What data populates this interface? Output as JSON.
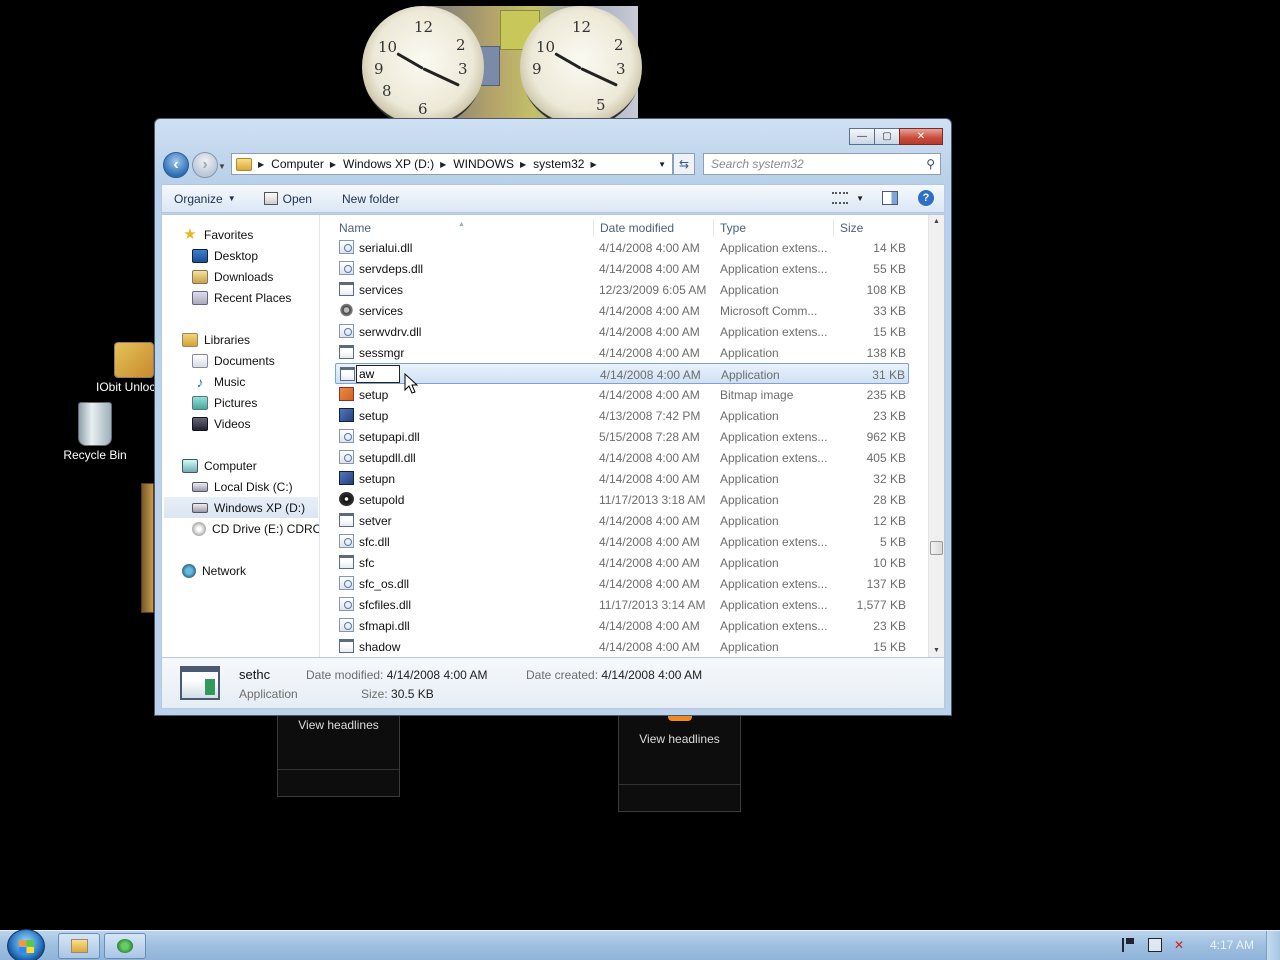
{
  "desktop": {
    "icons": [
      {
        "label": "IObit Unlocker"
      },
      {
        "label": "Recycle Bin"
      }
    ],
    "gadgets": {
      "headlines_left": "View headlines",
      "headlines_right": "View headlines"
    }
  },
  "window": {
    "caption_buttons": {
      "minimize": "—",
      "maximize": "▢",
      "close": "✕"
    },
    "address": {
      "crumbs": [
        "Computer",
        "Windows XP (D:)",
        "WINDOWS",
        "system32"
      ]
    },
    "search": {
      "placeholder": "Search system32"
    },
    "toolbar": {
      "organize": "Organize",
      "open": "Open",
      "new_folder": "New folder"
    },
    "nav_pane": {
      "favorites": "Favorites",
      "desktop": "Desktop",
      "downloads": "Downloads",
      "recent_places": "Recent Places",
      "libraries": "Libraries",
      "documents": "Documents",
      "music": "Music",
      "pictures": "Pictures",
      "videos": "Videos",
      "computer": "Computer",
      "local_disk": "Local Disk (C:)",
      "windows_xp": "Windows XP (D:)",
      "cd_drive": "CD Drive (E:) CDROM",
      "network": "Network"
    },
    "columns": {
      "name": "Name",
      "date": "Date modified",
      "type": "Type",
      "size": "Size"
    },
    "files": [
      {
        "name": "serialui.dll",
        "date": "4/14/2008 4:00 AM",
        "type": "Application extens...",
        "size": "14 KB",
        "icon": "dll"
      },
      {
        "name": "servdeps.dll",
        "date": "4/14/2008 4:00 AM",
        "type": "Application extens...",
        "size": "55 KB",
        "icon": "dll"
      },
      {
        "name": "services",
        "date": "12/23/2009 6:05 AM",
        "type": "Application",
        "size": "108 KB",
        "icon": "app"
      },
      {
        "name": "services",
        "date": "4/14/2008 4:00 AM",
        "type": "Microsoft Comm...",
        "size": "33 KB",
        "icon": "gear"
      },
      {
        "name": "serwvdrv.dll",
        "date": "4/14/2008 4:00 AM",
        "type": "Application extens...",
        "size": "15 KB",
        "icon": "dll"
      },
      {
        "name": "sessmgr",
        "date": "4/14/2008 4:00 AM",
        "type": "Application",
        "size": "138 KB",
        "icon": "app"
      },
      {
        "name": "aw",
        "date": "4/14/2008 4:00 AM",
        "type": "Application",
        "size": "31 KB",
        "icon": "app",
        "selected": true
      },
      {
        "name": "setup",
        "date": "4/14/2008 4:00 AM",
        "type": "Bitmap image",
        "size": "235 KB",
        "icon": "bmp"
      },
      {
        "name": "setup",
        "date": "4/13/2008 7:42 PM",
        "type": "Application",
        "size": "23 KB",
        "icon": "setup"
      },
      {
        "name": "setupapi.dll",
        "date": "5/15/2008 7:28 AM",
        "type": "Application extens...",
        "size": "962 KB",
        "icon": "dll"
      },
      {
        "name": "setupdll.dll",
        "date": "4/14/2008 4:00 AM",
        "type": "Application extens...",
        "size": "405 KB",
        "icon": "dll"
      },
      {
        "name": "setupn",
        "date": "4/14/2008 4:00 AM",
        "type": "Application",
        "size": "32 KB",
        "icon": "setup"
      },
      {
        "name": "setupold",
        "date": "11/17/2013 3:18 AM",
        "type": "Application",
        "size": "28 KB",
        "icon": "black"
      },
      {
        "name": "setver",
        "date": "4/14/2008 4:00 AM",
        "type": "Application",
        "size": "12 KB",
        "icon": "app"
      },
      {
        "name": "sfc.dll",
        "date": "4/14/2008 4:00 AM",
        "type": "Application extens...",
        "size": "5 KB",
        "icon": "dll"
      },
      {
        "name": "sfc",
        "date": "4/14/2008 4:00 AM",
        "type": "Application",
        "size": "10 KB",
        "icon": "app"
      },
      {
        "name": "sfc_os.dll",
        "date": "4/14/2008 4:00 AM",
        "type": "Application extens...",
        "size": "137 KB",
        "icon": "dll"
      },
      {
        "name": "sfcfiles.dll",
        "date": "11/17/2013 3:14 AM",
        "type": "Application extens...",
        "size": "1,577 KB",
        "icon": "dll"
      },
      {
        "name": "sfmapi.dll",
        "date": "4/14/2008 4:00 AM",
        "type": "Application extens...",
        "size": "23 KB",
        "icon": "dll"
      },
      {
        "name": "shadow",
        "date": "4/14/2008 4:00 AM",
        "type": "Application",
        "size": "15 KB",
        "icon": "app"
      }
    ],
    "details": {
      "name": "sethc",
      "kind": "Application",
      "date_modified_label": "Date modified:",
      "date_modified": "4/14/2008 4:00 AM",
      "date_created_label": "Date created:",
      "date_created": "4/14/2008 4:00 AM",
      "size_label": "Size:",
      "size": "30.5 KB"
    }
  },
  "taskbar": {
    "clock": "4:17 AM"
  },
  "colors": {
    "selection": "#cfe1f6",
    "selection_border": "#7da2ce",
    "taskbar": "#9fbfe0"
  }
}
